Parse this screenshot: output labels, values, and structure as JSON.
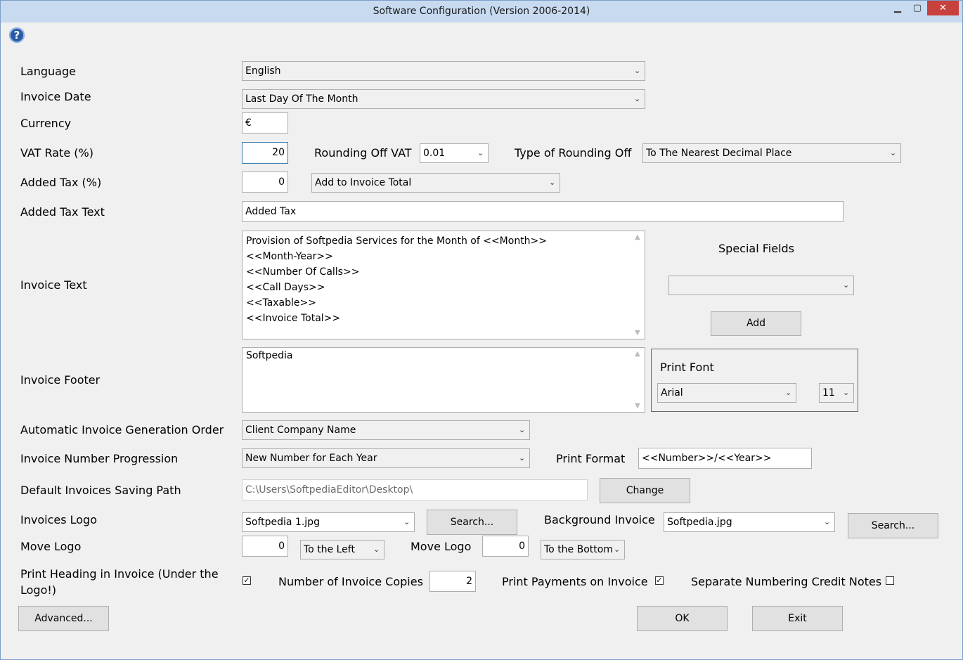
{
  "window": {
    "title": "Software Configuration (Version 2006-2014)",
    "minimize": "▁",
    "maximize": "▢",
    "close": "✕"
  },
  "help_icon": "?",
  "labels": {
    "language": "Language",
    "invoice_date": "Invoice Date",
    "currency": "Currency",
    "vat_rate": "VAT Rate (%)",
    "rounding_off_vat": "Rounding Off VAT",
    "type_of_rounding": "Type of Rounding Off",
    "added_tax": "Added Tax (%)",
    "added_tax_text": "Added Tax Text",
    "invoice_text": "Invoice Text",
    "special_fields": "Special Fields",
    "invoice_footer": "Invoice Footer",
    "print_font": "Print Font",
    "auto_order": "Automatic Invoice Generation Order",
    "number_progression": "Invoice Number Progression",
    "print_format": "Print Format",
    "saving_path": "Default Invoices Saving Path",
    "invoices_logo": "Invoices Logo",
    "background_invoice": "Background Invoice",
    "move_logo": "Move Logo",
    "move_logo2": "Move Logo",
    "print_heading": "Print Heading in Invoice (Under the Logo!)",
    "copies": "Number of Invoice Copies",
    "print_payments": "Print Payments on Invoice",
    "separate_numbering": "Separate Numbering Credit Notes"
  },
  "values": {
    "language": "English",
    "invoice_date": "Last Day Of The Month",
    "currency": "€",
    "vat_rate": "20",
    "rounding_off_vat": "0.01",
    "type_of_rounding": "To The Nearest Decimal Place",
    "added_tax": "0",
    "added_tax_mode": "Add to Invoice Total",
    "added_tax_text": "Added Tax",
    "invoice_text_lines": [
      "Provision of Softpedia Services for the Month of <<Month>>",
      "<<Month-Year>>",
      "<<Number Of Calls>>",
      "<<Call Days>>",
      "<<Taxable>>",
      "<<Invoice Total>>"
    ],
    "special_field": "",
    "invoice_footer": "Softpedia",
    "font_name": "Arial",
    "font_size": "11",
    "auto_order": "Client Company Name",
    "number_progression": "New Number for Each Year",
    "print_format": "<<Number>>/<<Year>>",
    "saving_path": "C:\\Users\\SoftpediaEditor\\Desktop\\",
    "invoices_logo": "Softpedia 1.jpg",
    "background_invoice": "Softpedia.jpg",
    "move_logo_x": "0",
    "move_logo_x_dir": "To the Left",
    "move_logo_y": "0",
    "move_logo_y_dir": "To the Bottom",
    "copies": "2",
    "print_heading_checked": true,
    "print_payments_checked": true,
    "separate_numbering_checked": false
  },
  "buttons": {
    "add": "Add",
    "change": "Change",
    "search_logo": "Search...",
    "search_background": "Search...",
    "advanced": "Advanced...",
    "ok": "OK",
    "exit": "Exit"
  },
  "glyphs": {
    "chevron": "⌄",
    "check": "✓",
    "scroll_up": "▲",
    "scroll_down": "▼"
  }
}
